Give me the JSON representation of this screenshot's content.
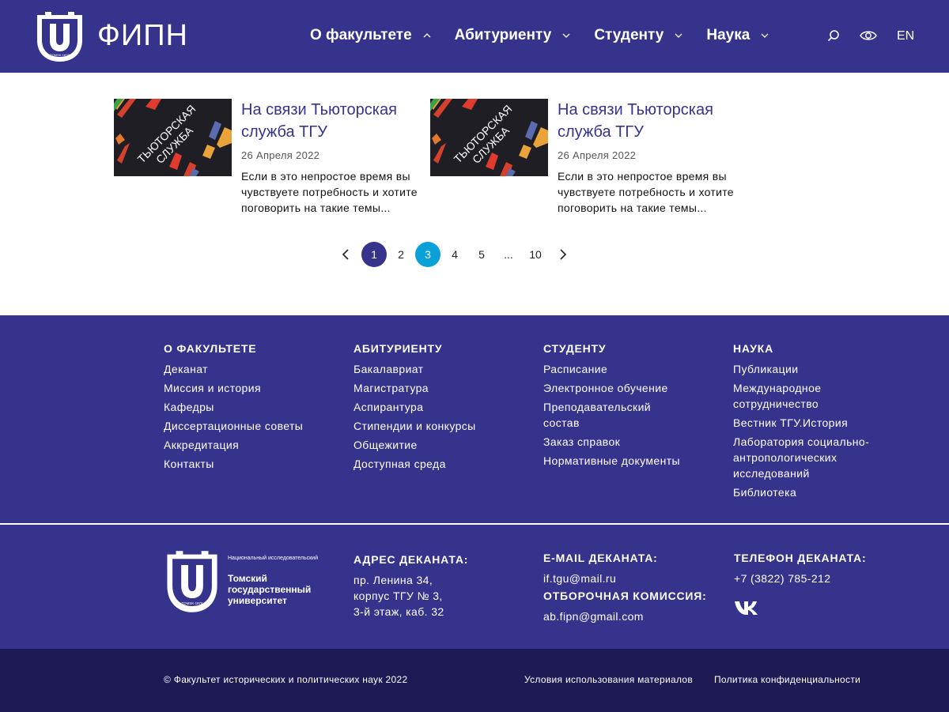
{
  "header": {
    "logo_text": "ФИПН",
    "nav": [
      {
        "label": "О факультете",
        "expanded": true
      },
      {
        "label": "Абитуриенту",
        "expanded": false
      },
      {
        "label": "Студенту",
        "expanded": false
      },
      {
        "label": "Наука",
        "expanded": false
      }
    ],
    "lang": "EN",
    "icons": [
      "search-icon",
      "visually-impaired-icon"
    ]
  },
  "news": [
    {
      "image_text": "ТЬЮТОРСКАЯ СЛУЖБА",
      "title": "На связи Тьюторская служба ТГУ",
      "date": "26 Апреля 2022",
      "excerpt": "Если в это непростое время вы чувствуете потребность и хотите поговорить на такие темы..."
    },
    {
      "image_text": "ТЬЮТОРСКАЯ СЛУЖБА",
      "title": "На связи Тьюторская служба ТГУ",
      "date": "26 Апреля 2022",
      "excerpt": "Если в это непростое время вы чувствуете потребность и хотите поговорить на такие темы..."
    }
  ],
  "pagination": {
    "pages": [
      "1",
      "2",
      "3",
      "4",
      "5",
      "...",
      "10"
    ],
    "active": "1",
    "current": "3"
  },
  "footer": {
    "columns": [
      {
        "title": "О ФАКУЛЬТЕТЕ",
        "links": [
          "Деканат",
          "Миссия и история",
          "Кафедры",
          "Диссертационные советы",
          "Аккредитация",
          "Контакты"
        ]
      },
      {
        "title": "АБИТУРИЕНТУ",
        "links": [
          "Бакалавриат",
          "Магистратура",
          "Аспирантура",
          "Стипендии и конкурсы",
          "Общежитие",
          "Доступная среда"
        ]
      },
      {
        "title": "СТУДЕНТУ",
        "links": [
          "Расписание",
          "Электронное обучение",
          "Преподавательский состав",
          "Заказ справок",
          "Нормативные документы"
        ]
      },
      {
        "title": "НАУКА",
        "links": [
          "Публикации",
          "Международное сотрудничество",
          "Вестник ТГУ.История",
          "Лаборатория социально-антропологических исследований",
          "Библиотека"
        ]
      }
    ],
    "tsu": {
      "small": "Национальный исследовательский",
      "big": "Томский государственный университет",
      "shield_caption": "TOMSK·1878"
    },
    "address": {
      "title": "АДРЕС ДЕКАНАТА:",
      "lines": [
        "пр. Ленина 34,",
        "корпус ТГУ № 3,",
        "3-й этаж, каб. 32"
      ]
    },
    "email": {
      "title": "E-MAIL ДЕКАНАТА:",
      "value": "if.tgu@mail.ru"
    },
    "admission": {
      "title": "ОТБОРОЧНАЯ КОМИССИЯ:",
      "value": "ab.fipn@gmail.com"
    },
    "phone": {
      "title": "ТЕЛЕФОН ДЕКАНАТА:",
      "value": "+7 (3822) 785-212"
    },
    "social": [
      "vk-icon"
    ]
  },
  "bottom": {
    "copyright": "© Факультет исторических и политических наук 2022",
    "terms": "Условия использования материалов",
    "privacy": "Политика конфиденциальности"
  },
  "colors": {
    "primary": "#35338c",
    "accent": "#0aa0d8",
    "dark": "#1d1a55"
  }
}
